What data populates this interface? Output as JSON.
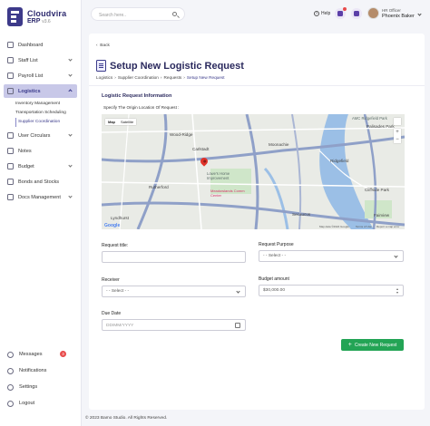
{
  "brand": {
    "name": "Cloudvira",
    "sub": "ERP",
    "version": "v3.6"
  },
  "sidebar": {
    "items": [
      {
        "label": "Dashboard"
      },
      {
        "label": "Staff List"
      },
      {
        "label": "Payroll List"
      },
      {
        "label": "Logistics"
      },
      {
        "label": "User Circulars"
      },
      {
        "label": "Notes"
      },
      {
        "label": "Budget"
      },
      {
        "label": "Bonds and Stocks"
      },
      {
        "label": "Docs Management"
      }
    ],
    "logistics_sub": [
      "Inventory Management",
      "Transportation Scheduling",
      "Supplier Coordination"
    ],
    "bottom": [
      {
        "label": "Messages",
        "badge": "3"
      },
      {
        "label": "Notifications"
      },
      {
        "label": "Settings"
      },
      {
        "label": "Logout"
      }
    ]
  },
  "topbar": {
    "search_placeholder": "Search here..",
    "help": "Help",
    "user_role": "HR Officer",
    "user_name": "Phoenix Baker"
  },
  "page": {
    "back": "Back",
    "title": "Setup New Logistic Request",
    "breadcrumb": [
      "Logistics",
      "Supplier Coordination",
      "Requests",
      "Setup New Request"
    ],
    "section_title": "Logistic Request Information",
    "map_label": "Specify The Origin Location Of Request :"
  },
  "map": {
    "type_map": "Map",
    "type_satellite": "Satellite",
    "places": {
      "wood_ridge": "Wood-Ridge",
      "carlstadt": "Carlstadt",
      "moonachie": "Moonachie",
      "rutherford": "Rutherford",
      "lowes": "Lowe's Home Improvement",
      "meadowlands": "Meadowlands Comm Center",
      "amc": "AMC Ridgefield Park",
      "palisades": "Palisades Park",
      "ridgefield": "Ridgefield",
      "cliffside": "Cliffside Park",
      "fairview": "Fairview",
      "lyndhurst": "Lyndhurst",
      "secaucus": "Secaucus"
    },
    "footer_data": "Map data ©2024 Google",
    "footer_terms": "Terms of Use",
    "footer_report": "Report a map error",
    "google": "Google"
  },
  "form": {
    "request_title_label": "Request title:",
    "request_title_value": "",
    "request_purpose_label": "Request Purpose",
    "request_purpose_value": "- - Select - -",
    "receiver_label": "Receiver",
    "receiver_value": "- - Select - -",
    "budget_label": "Budget amount",
    "budget_value": "$30,000.00",
    "due_date_label": "Due Date",
    "due_date_placeholder": "DD/MM/YYYY",
    "submit_label": "Create New Request"
  },
  "footer": "© 2023 Bamo Studio. All Rights Reserved.",
  "colors": {
    "accent": "#2b2a5e",
    "active_bg": "#c8c8e8",
    "submit": "#23a455",
    "badge": "#e84a4a"
  }
}
